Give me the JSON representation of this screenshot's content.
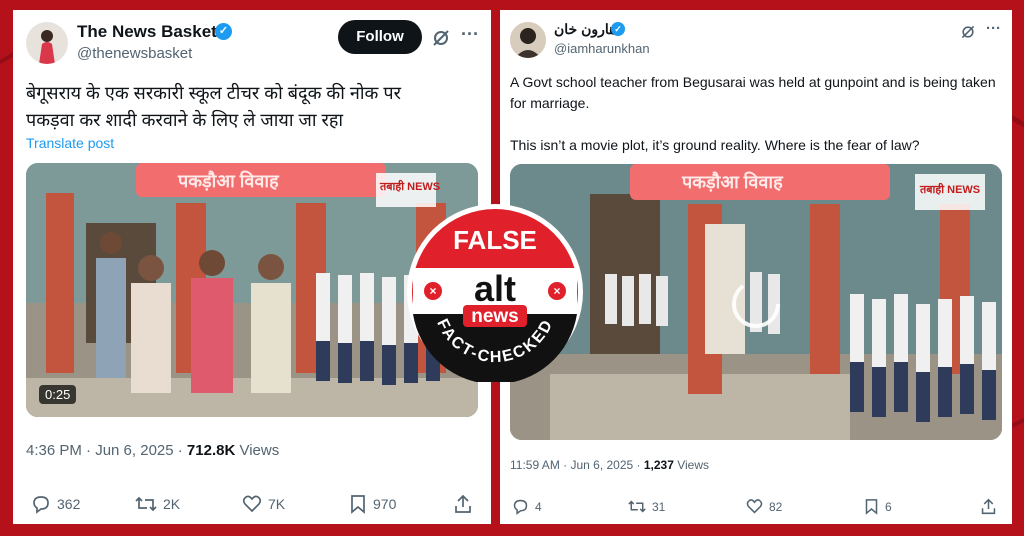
{
  "left_post": {
    "display_name": "The News Basket",
    "handle": "@thenewsbasket",
    "follow_label": "Follow",
    "text": "बेगूसराय के एक सरकारी स्कूल टीचर को बंदूक की नोक पर पकड़वा कर शादी करवाने के लिए ले जाया जा रहा",
    "translate_label": "Translate post",
    "video_banner": "पकड़ौआ विवाह",
    "video_watermark": "तबाही NEWS",
    "video_duration": "0:25",
    "time": "4:36 PM · Jun 6, 2025 · ",
    "views_count": "712.8K",
    "views_label": " Views",
    "replies": "362",
    "reposts": "2K",
    "likes": "7K",
    "bookmarks": "970"
  },
  "right_post": {
    "display_name": "هارون خان",
    "handle": "@iamharunkhan",
    "text_line1": "A Govt school teacher from Begusarai was held at gunpoint and is being taken for marriage.",
    "text_line2": "This isn’t a movie plot, it’s ground reality. Where is the fear of law?",
    "video_banner": "पकड़ौआ विवाह",
    "video_watermark": "तबाही NEWS",
    "time": "11:59 AM · Jun 6, 2025 · ",
    "views_count": "1,237",
    "views_label": " Views",
    "replies": "4",
    "reposts": "31",
    "likes": "82",
    "bookmarks": "6"
  },
  "stamp": {
    "top_text": "FALSE",
    "logo_top": "alt",
    "logo_bottom": "news",
    "bottom_text": "FACT-CHECKED"
  },
  "icons": {
    "more": "more-icon",
    "grok": "grok-icon",
    "reply": "reply-icon",
    "repost": "repost-icon",
    "like": "like-icon",
    "bookmark": "bookmark-icon",
    "share": "share-icon"
  },
  "colors": {
    "background": "#b5111b",
    "verified": "#1d9bf0",
    "stamp_red": "#e0202a"
  }
}
